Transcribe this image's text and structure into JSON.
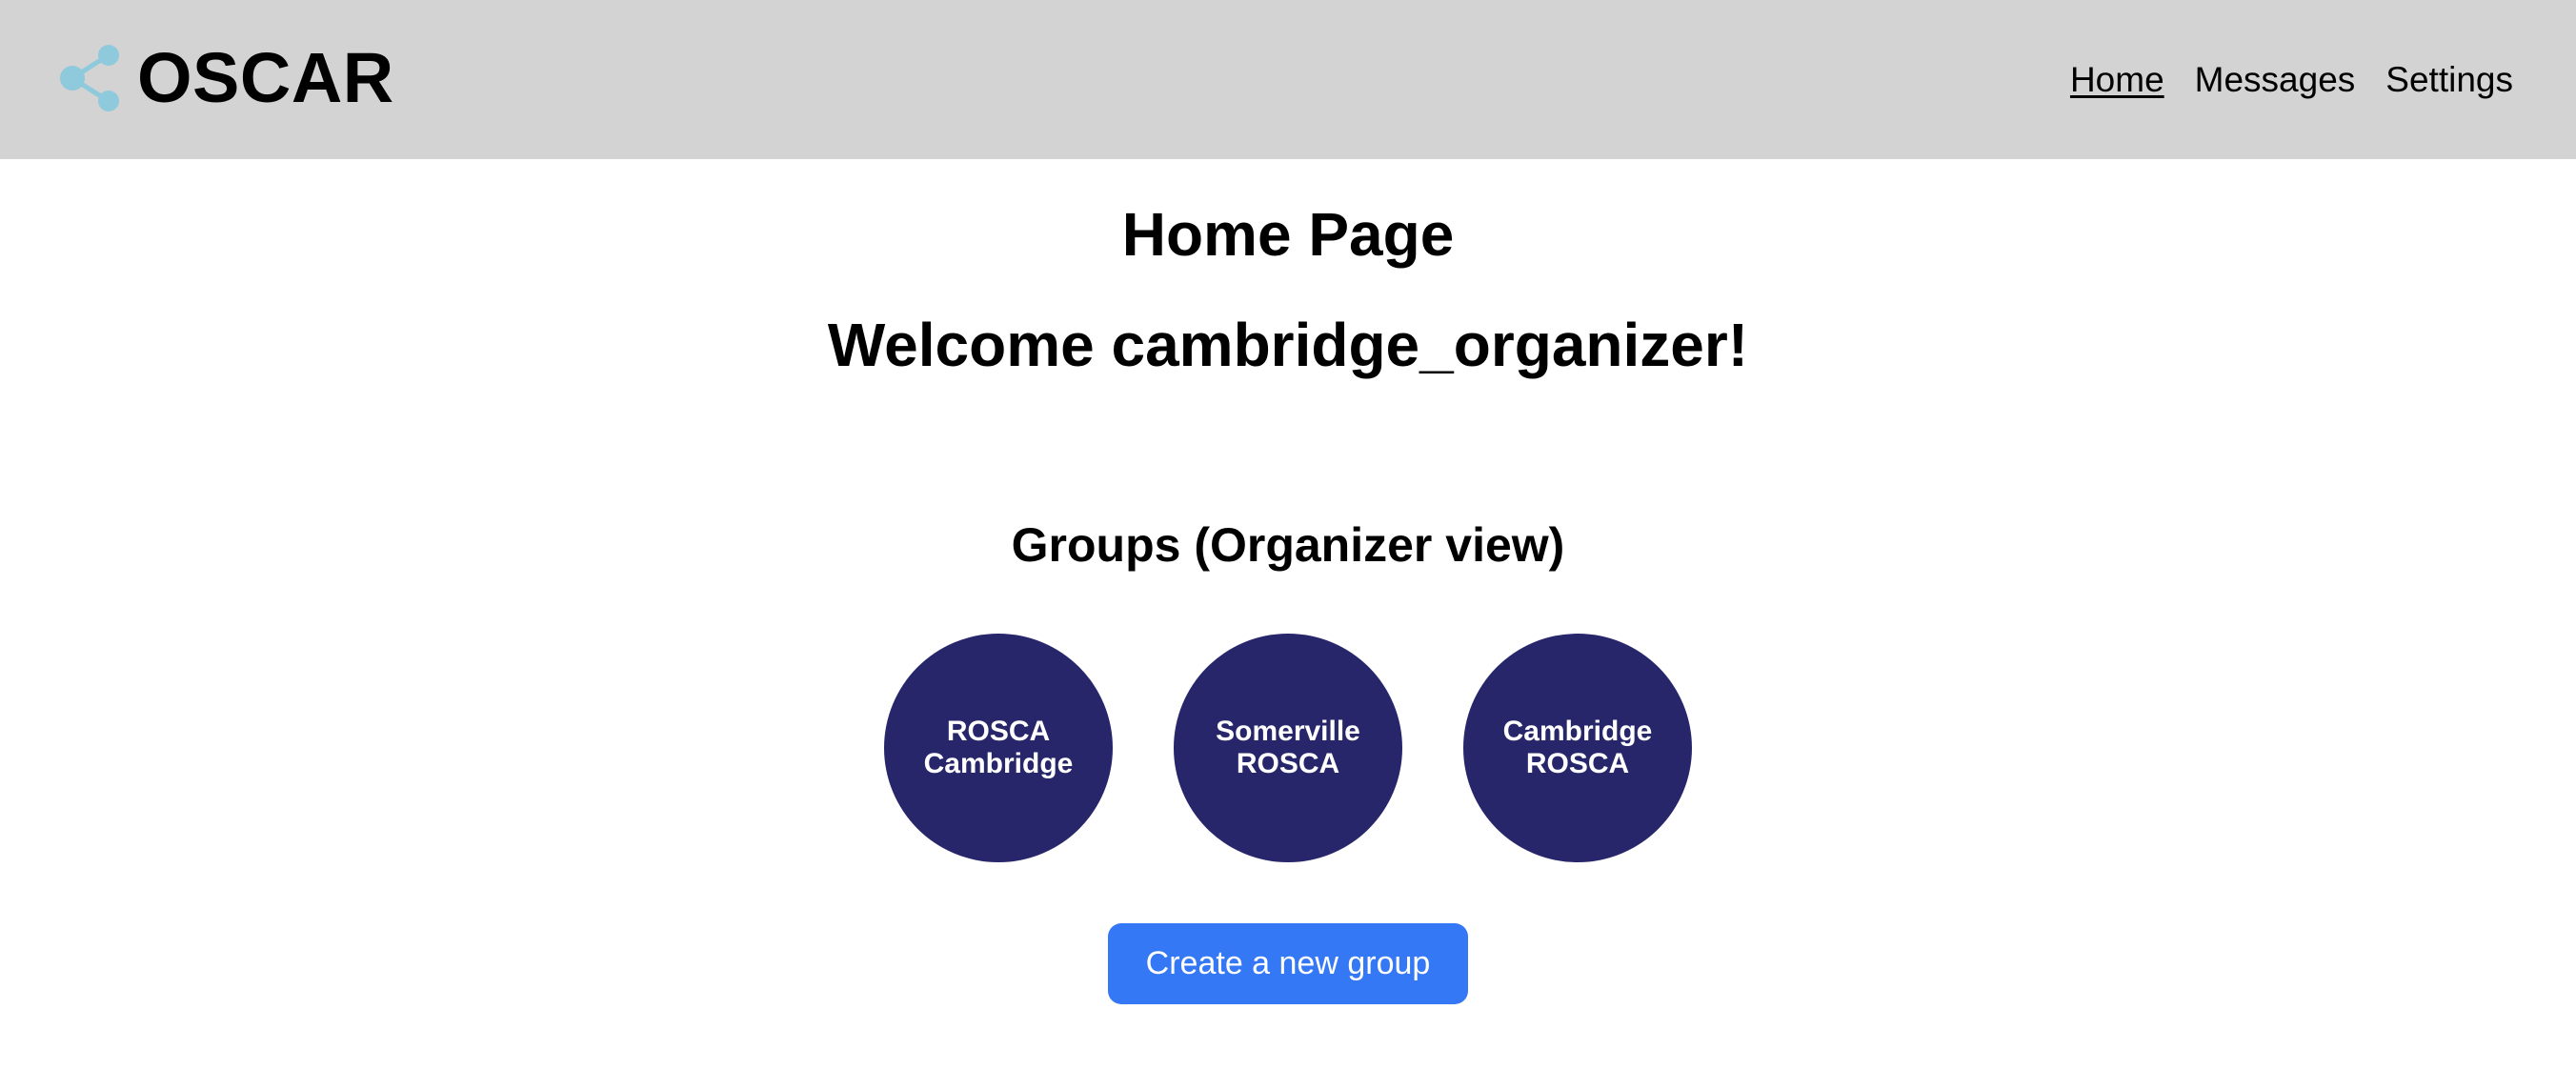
{
  "brand": {
    "name": "OSCAR",
    "icon": "share-icon",
    "icon_color": "#8ec9dc"
  },
  "nav": {
    "items": [
      {
        "label": "Home",
        "active": true
      },
      {
        "label": "Messages",
        "active": false
      },
      {
        "label": "Settings",
        "active": false
      }
    ]
  },
  "page": {
    "title": "Home Page",
    "welcome": "Welcome cambridge_organizer!",
    "groups_heading": "Groups (Organizer view)"
  },
  "groups": [
    {
      "name": "ROSCA Cambridge"
    },
    {
      "name": "Somerville ROSCA"
    },
    {
      "name": "Cambridge ROSCA"
    }
  ],
  "actions": {
    "create_group_label": "Create a new group"
  },
  "colors": {
    "navbar_bg": "#d3d3d3",
    "group_circle": "#27266b",
    "primary_button": "#3478f6"
  }
}
